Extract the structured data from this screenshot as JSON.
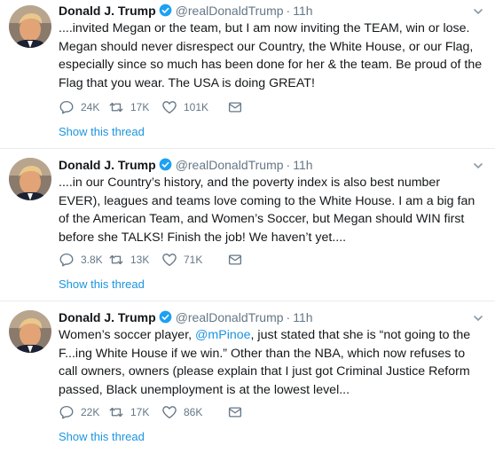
{
  "tweets": [
    {
      "author_name": "Donald J. Trump",
      "handle": "@realDonaldTrump",
      "separator": "·",
      "time": "11h",
      "text": "....invited Megan or the team, but I am now inviting the TEAM, win or lose. Megan should never disrespect our Country, the White House, or our Flag, especially since so much has been done for her & the team. Be proud of the Flag that you wear. The USA is doing GREAT!",
      "replies": "24K",
      "retweets": "17K",
      "likes": "101K",
      "thread_link": "Show this thread"
    },
    {
      "author_name": "Donald J. Trump",
      "handle": "@realDonaldTrump",
      "separator": "·",
      "time": "11h",
      "text": "....in our Country’s history, and the poverty index is also best number EVER), leagues and teams love coming to the White House. I am a big fan of the American Team, and Women’s Soccer, but Megan should WIN first before she TALKS! Finish the job! We haven’t yet....",
      "replies": "3.8K",
      "retweets": "13K",
      "likes": "71K",
      "thread_link": "Show this thread"
    },
    {
      "author_name": "Donald J. Trump",
      "handle": "@realDonaldTrump",
      "separator": "·",
      "time": "11h",
      "text_before": "Women’s soccer player, ",
      "mention": "@mPinoe",
      "text_after": ", just stated that she is “not going to the F...ing White House if we win.” Other than the NBA, which now refuses to call owners, owners (please explain that I just got Criminal Justice Reform passed, Black unemployment is at the lowest level...",
      "replies": "22K",
      "retweets": "17K",
      "likes": "86K",
      "thread_link": "Show this thread"
    }
  ],
  "icons": {
    "reply": "reply-icon",
    "retweet": "retweet-icon",
    "like": "heart-icon",
    "dm": "envelope-icon",
    "verified": "verified-badge-icon",
    "caret": "chevron-down-icon"
  },
  "colors": {
    "link": "#1b95e0",
    "muted": "#657786",
    "text": "#14171a",
    "verified": "#1da1f2"
  }
}
